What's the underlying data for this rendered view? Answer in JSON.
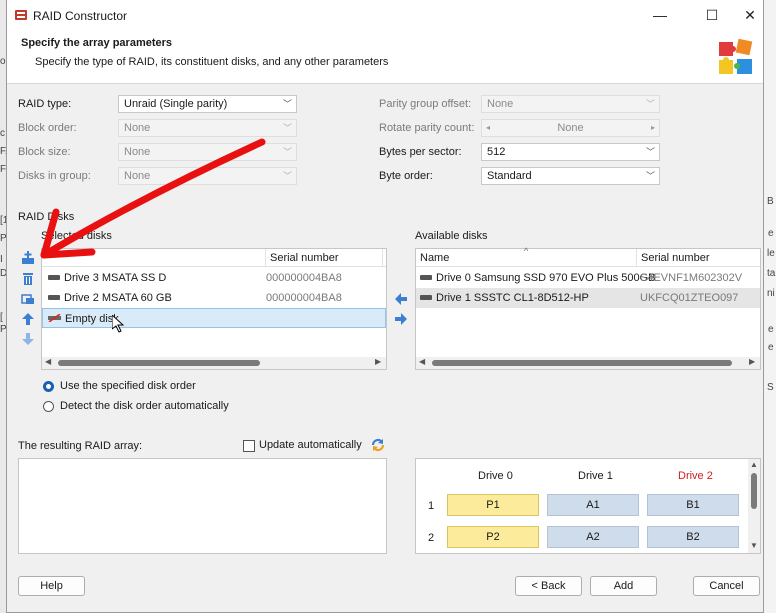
{
  "window": {
    "title": "RAID Constructor",
    "minimize": "—",
    "maximize": "☐",
    "close": "✕"
  },
  "header": {
    "title": "Specify the array parameters",
    "subtitle": "Specify the type of RAID, its constituent disks, and any other parameters"
  },
  "params_left": {
    "raid_type_label": "RAID type:",
    "raid_type_value": "Unraid (Single parity)",
    "block_order_label": "Block order:",
    "block_order_value": "None",
    "block_size_label": "Block size:",
    "block_size_value": "None",
    "disks_in_group_label": "Disks in group:",
    "disks_in_group_value": "None"
  },
  "params_right": {
    "parity_offset_label": "Parity group offset:",
    "parity_offset_value": "None",
    "rotate_parity_label": "Rotate parity count:",
    "rotate_parity_value": "None",
    "bytes_sector_label": "Bytes per sector:",
    "bytes_sector_value": "512",
    "byte_order_label": "Byte order:",
    "byte_order_value": "Standard"
  },
  "raid_disks": {
    "group_label": "RAID Disks",
    "selected_label": "Selected disks",
    "col_serial": "Serial number",
    "rows": [
      {
        "name": "Drive 3 MSATA SS D",
        "serial": "000000004BA8"
      },
      {
        "name": "Drive 2 MSATA 60 GB",
        "serial": "000000004BA8"
      },
      {
        "name": "Empty disk",
        "serial": ""
      }
    ]
  },
  "available": {
    "label": "Available disks",
    "col_name": "Name",
    "col_serial": "Serial number",
    "rows": [
      {
        "name": "Drive 0 Samsung SSD 970 EVO Plus 500GB",
        "serial": "S4EVNF1M602302V"
      },
      {
        "name": "Drive 1 SSSTC CL1-8D512-HP",
        "serial": "UKFCQ01ZTEO097"
      }
    ]
  },
  "order": {
    "use_specified": "Use the specified disk order",
    "detect_auto": "Detect the disk order automatically"
  },
  "result": {
    "label": "The resulting RAID array:",
    "update_auto": "Update automatically"
  },
  "grid": {
    "headers": [
      "Drive 0",
      "Drive 1",
      "Drive 2"
    ],
    "rows": [
      {
        "num": "1",
        "cells": [
          "P1",
          "A1",
          "B1"
        ]
      },
      {
        "num": "2",
        "cells": [
          "P2",
          "A2",
          "B2"
        ]
      }
    ],
    "parity_color": "#fbeb9a",
    "data_color": "#cfdceb",
    "missing_drive_color": "#cc2020"
  },
  "buttons": {
    "help": "Help",
    "back": "< Back",
    "add": "Add",
    "cancel": "Cancel"
  },
  "icons": {
    "add_disk": "add-icon",
    "remove_disk": "trash-icon",
    "move_up": "up-arrow-icon",
    "move_down": "down-arrow-icon",
    "move_left": "left-arrow-icon",
    "move_right": "right-arrow-icon",
    "refresh": "refresh-icon",
    "app": "raid-icon",
    "puzzle": "puzzle-icon"
  },
  "background": {
    "left_frags": [
      "o",
      "c",
      "FA",
      "Fi",
      "[1",
      "I",
      "D",
      "Pi",
      "[",
      "Pi"
    ],
    "right_frags": [
      "B",
      "e",
      "le",
      "ta",
      "ni",
      "e",
      "e",
      "S"
    ]
  }
}
